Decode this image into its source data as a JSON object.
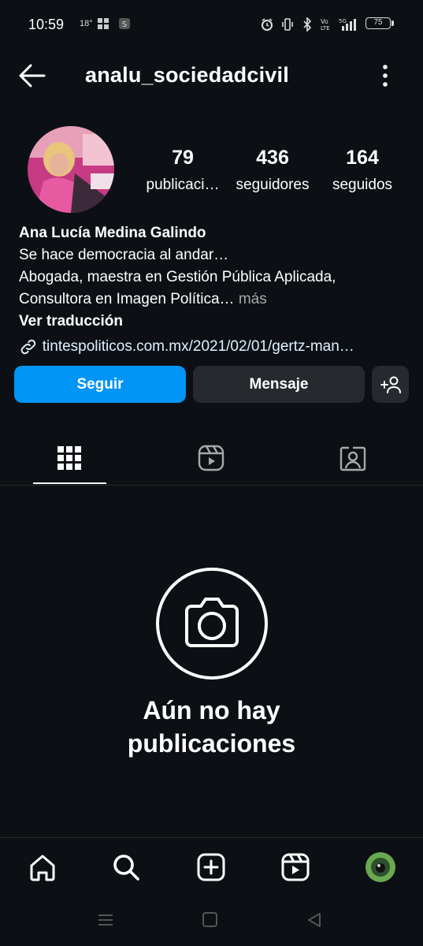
{
  "status_bar": {
    "time": "10:59",
    "temperature": "18°",
    "battery": "75",
    "icons": [
      "windows-icon",
      "shield-s-icon",
      "alarm-icon",
      "vibrate-icon",
      "bluetooth-icon",
      "volte-icon",
      "5g-signal-icon",
      "battery-icon"
    ]
  },
  "header": {
    "username": "analu_sociedadcivil",
    "back_icon": "arrow-left-icon",
    "more_icon": "vertical-dots-icon"
  },
  "stats": [
    {
      "value": "79",
      "label": "publicaci…"
    },
    {
      "value": "436",
      "label": "seguidores"
    },
    {
      "value": "164",
      "label": "seguidos"
    }
  ],
  "bio": {
    "name": "Ana Lucía Medina Galindo",
    "line1": "Se hace democracia al andar…",
    "line2": "Abogada, maestra en Gestión Pública Aplicada,",
    "line3": "Consultora en Imagen Política…",
    "more": " más",
    "translate": "Ver traducción",
    "link": "tintespoliticos.com.mx/2021/02/01/gertz-man…"
  },
  "buttons": {
    "follow": "Seguir",
    "message": "Mensaje"
  },
  "tabs": [
    "grid-icon",
    "reels-icon",
    "tagged-icon"
  ],
  "empty_state": {
    "line1": "Aún no hay",
    "line2": "publicaciones"
  },
  "bottom_nav": [
    "home-icon",
    "search-icon",
    "create-icon",
    "reels-icon",
    "profile-avatar"
  ],
  "colors": {
    "background": "#0c1014",
    "follow_button": "#0095f6",
    "secondary_button": "#262a2f",
    "link": "#e0f1ff"
  }
}
